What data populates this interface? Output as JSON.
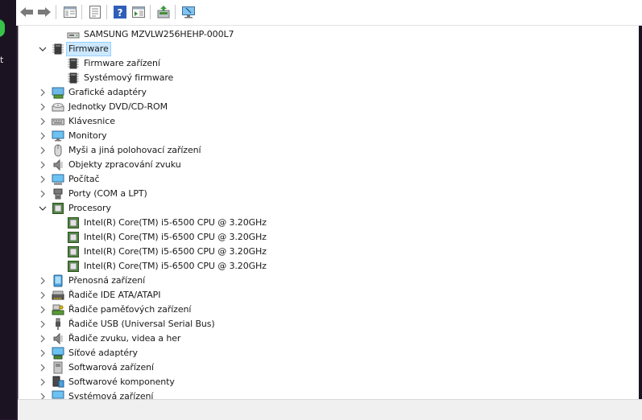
{
  "colors": {
    "selection": "#cce8ff",
    "text": "#1a1a1a",
    "folder_blue": "#3a8fd6"
  },
  "toolbar": {
    "buttons": [
      {
        "name": "back-button",
        "icon": "arrow-left-icon"
      },
      {
        "name": "forward-button",
        "icon": "arrow-right-icon"
      },
      {
        "name": "show-hide-console-tree-button",
        "icon": "console-tree-icon"
      },
      {
        "name": "properties-button",
        "icon": "properties-icon"
      },
      {
        "name": "help-button",
        "icon": "help-icon"
      },
      {
        "name": "action-pane-button",
        "icon": "action-pane-icon"
      },
      {
        "name": "update-driver-button",
        "icon": "update-driver-icon"
      },
      {
        "name": "scan-hardware-button",
        "icon": "monitor-scan-icon"
      }
    ]
  },
  "left_strip": {
    "glyph": "t"
  },
  "tree": [
    {
      "label": "SAMSUNG MZVLW256HEHP-000L7",
      "level": 1,
      "icon": "disk-icon"
    },
    {
      "label": "Firmware",
      "level": 0,
      "expanded": true,
      "selected": true,
      "icon": "firmware-chip-icon"
    },
    {
      "label": "Firmware zařízení",
      "level": 1,
      "icon": "firmware-chip-icon"
    },
    {
      "label": "Systémový firmware",
      "level": 1,
      "icon": "firmware-chip-icon"
    },
    {
      "label": "Grafické adaptéry",
      "level": 0,
      "expanded": false,
      "icon": "display-adapter-icon"
    },
    {
      "label": "Jednotky DVD/CD-ROM",
      "level": 0,
      "expanded": false,
      "icon": "dvd-drive-icon"
    },
    {
      "label": "Klávesnice",
      "level": 0,
      "expanded": false,
      "icon": "keyboard-icon"
    },
    {
      "label": "Monitory",
      "level": 0,
      "expanded": false,
      "icon": "monitor-icon"
    },
    {
      "label": "Myši a jiná polohovací zařízení",
      "level": 0,
      "expanded": false,
      "icon": "mouse-icon"
    },
    {
      "label": "Objekty zpracování zvuku",
      "level": 0,
      "expanded": false,
      "icon": "speaker-icon"
    },
    {
      "label": "Počítač",
      "level": 0,
      "expanded": false,
      "icon": "computer-icon"
    },
    {
      "label": "Porty (COM a LPT)",
      "level": 0,
      "expanded": false,
      "icon": "port-icon"
    },
    {
      "label": "Procesory",
      "level": 0,
      "expanded": true,
      "icon": "processor-icon"
    },
    {
      "label": "Intel(R) Core(TM) i5-6500 CPU @ 3.20GHz",
      "level": 1,
      "icon": "processor-icon"
    },
    {
      "label": "Intel(R) Core(TM) i5-6500 CPU @ 3.20GHz",
      "level": 1,
      "icon": "processor-icon"
    },
    {
      "label": "Intel(R) Core(TM) i5-6500 CPU @ 3.20GHz",
      "level": 1,
      "icon": "processor-icon"
    },
    {
      "label": "Intel(R) Core(TM) i5-6500 CPU @ 3.20GHz",
      "level": 1,
      "icon": "processor-icon"
    },
    {
      "label": "Přenosná zařízení",
      "level": 0,
      "expanded": false,
      "icon": "portable-device-icon"
    },
    {
      "label": "Řadiče IDE ATA/ATAPI",
      "level": 0,
      "expanded": false,
      "icon": "ide-controller-icon"
    },
    {
      "label": "Řadiče paměťových zařízení",
      "level": 0,
      "expanded": false,
      "icon": "storage-controller-icon"
    },
    {
      "label": "Řadiče USB (Universal Serial Bus)",
      "level": 0,
      "expanded": false,
      "icon": "usb-icon"
    },
    {
      "label": "Řadiče zvuku, videa a her",
      "level": 0,
      "expanded": false,
      "icon": "speaker-icon"
    },
    {
      "label": "Síťové adaptéry",
      "level": 0,
      "expanded": false,
      "icon": "network-adapter-icon"
    },
    {
      "label": "Softwarová zařízení",
      "level": 0,
      "expanded": false,
      "icon": "software-device-icon"
    },
    {
      "label": "Softwarové komponenty",
      "level": 0,
      "expanded": false,
      "icon": "software-component-icon"
    },
    {
      "label": "Systémová zařízení",
      "level": 0,
      "expanded": false,
      "icon": "system-device-icon"
    }
  ]
}
